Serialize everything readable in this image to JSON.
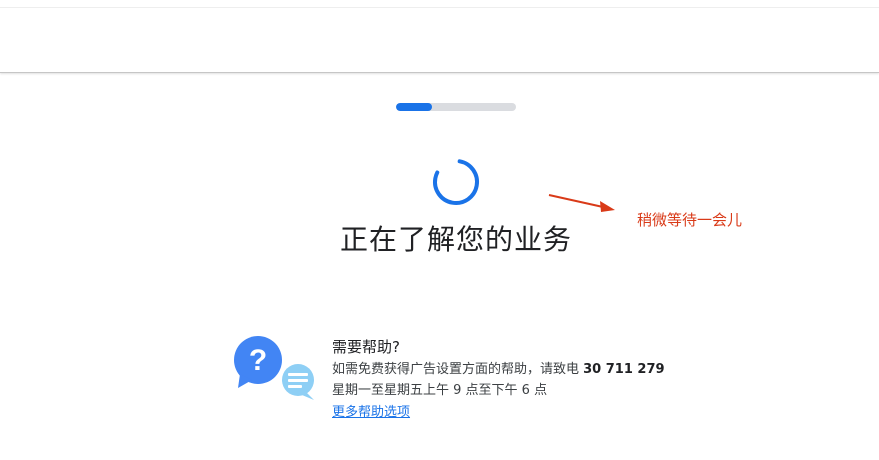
{
  "progress": {
    "value": 0.3
  },
  "main": {
    "heading": "正在了解您的业务"
  },
  "annotation": {
    "text": "稍微等待一会儿",
    "color": "#d93a18"
  },
  "help": {
    "title": "需要帮助?",
    "line1_prefix": "如需免费获得广告设置方面的帮助，请致电 ",
    "phone": "30 711 279",
    "line2": "星期一至星期五上午 9 点至下午 6 点",
    "link_label": "更多帮助选项"
  },
  "colors": {
    "accent": "#1a73e8",
    "track": "#dadce0",
    "annotation": "#d93a18"
  },
  "icons": {
    "spinner": "loading-spinner-icon",
    "help": "help-question-bubble-icon",
    "chat": "chat-bubble-icon",
    "arrow": "annotation-arrow-icon"
  }
}
